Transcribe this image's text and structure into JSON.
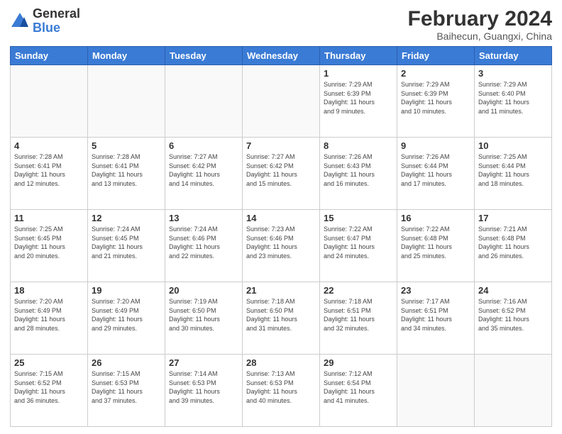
{
  "header": {
    "logo_general": "General",
    "logo_blue": "Blue",
    "title": "February 2024",
    "subtitle": "Baihecun, Guangxi, China"
  },
  "weekdays": [
    "Sunday",
    "Monday",
    "Tuesday",
    "Wednesday",
    "Thursday",
    "Friday",
    "Saturday"
  ],
  "weeks": [
    [
      {
        "day": "",
        "info": ""
      },
      {
        "day": "",
        "info": ""
      },
      {
        "day": "",
        "info": ""
      },
      {
        "day": "",
        "info": ""
      },
      {
        "day": "1",
        "info": "Sunrise: 7:29 AM\nSunset: 6:39 PM\nDaylight: 11 hours\nand 9 minutes."
      },
      {
        "day": "2",
        "info": "Sunrise: 7:29 AM\nSunset: 6:39 PM\nDaylight: 11 hours\nand 10 minutes."
      },
      {
        "day": "3",
        "info": "Sunrise: 7:29 AM\nSunset: 6:40 PM\nDaylight: 11 hours\nand 11 minutes."
      }
    ],
    [
      {
        "day": "4",
        "info": "Sunrise: 7:28 AM\nSunset: 6:41 PM\nDaylight: 11 hours\nand 12 minutes."
      },
      {
        "day": "5",
        "info": "Sunrise: 7:28 AM\nSunset: 6:41 PM\nDaylight: 11 hours\nand 13 minutes."
      },
      {
        "day": "6",
        "info": "Sunrise: 7:27 AM\nSunset: 6:42 PM\nDaylight: 11 hours\nand 14 minutes."
      },
      {
        "day": "7",
        "info": "Sunrise: 7:27 AM\nSunset: 6:42 PM\nDaylight: 11 hours\nand 15 minutes."
      },
      {
        "day": "8",
        "info": "Sunrise: 7:26 AM\nSunset: 6:43 PM\nDaylight: 11 hours\nand 16 minutes."
      },
      {
        "day": "9",
        "info": "Sunrise: 7:26 AM\nSunset: 6:44 PM\nDaylight: 11 hours\nand 17 minutes."
      },
      {
        "day": "10",
        "info": "Sunrise: 7:25 AM\nSunset: 6:44 PM\nDaylight: 11 hours\nand 18 minutes."
      }
    ],
    [
      {
        "day": "11",
        "info": "Sunrise: 7:25 AM\nSunset: 6:45 PM\nDaylight: 11 hours\nand 20 minutes."
      },
      {
        "day": "12",
        "info": "Sunrise: 7:24 AM\nSunset: 6:45 PM\nDaylight: 11 hours\nand 21 minutes."
      },
      {
        "day": "13",
        "info": "Sunrise: 7:24 AM\nSunset: 6:46 PM\nDaylight: 11 hours\nand 22 minutes."
      },
      {
        "day": "14",
        "info": "Sunrise: 7:23 AM\nSunset: 6:46 PM\nDaylight: 11 hours\nand 23 minutes."
      },
      {
        "day": "15",
        "info": "Sunrise: 7:22 AM\nSunset: 6:47 PM\nDaylight: 11 hours\nand 24 minutes."
      },
      {
        "day": "16",
        "info": "Sunrise: 7:22 AM\nSunset: 6:48 PM\nDaylight: 11 hours\nand 25 minutes."
      },
      {
        "day": "17",
        "info": "Sunrise: 7:21 AM\nSunset: 6:48 PM\nDaylight: 11 hours\nand 26 minutes."
      }
    ],
    [
      {
        "day": "18",
        "info": "Sunrise: 7:20 AM\nSunset: 6:49 PM\nDaylight: 11 hours\nand 28 minutes."
      },
      {
        "day": "19",
        "info": "Sunrise: 7:20 AM\nSunset: 6:49 PM\nDaylight: 11 hours\nand 29 minutes."
      },
      {
        "day": "20",
        "info": "Sunrise: 7:19 AM\nSunset: 6:50 PM\nDaylight: 11 hours\nand 30 minutes."
      },
      {
        "day": "21",
        "info": "Sunrise: 7:18 AM\nSunset: 6:50 PM\nDaylight: 11 hours\nand 31 minutes."
      },
      {
        "day": "22",
        "info": "Sunrise: 7:18 AM\nSunset: 6:51 PM\nDaylight: 11 hours\nand 32 minutes."
      },
      {
        "day": "23",
        "info": "Sunrise: 7:17 AM\nSunset: 6:51 PM\nDaylight: 11 hours\nand 34 minutes."
      },
      {
        "day": "24",
        "info": "Sunrise: 7:16 AM\nSunset: 6:52 PM\nDaylight: 11 hours\nand 35 minutes."
      }
    ],
    [
      {
        "day": "25",
        "info": "Sunrise: 7:15 AM\nSunset: 6:52 PM\nDaylight: 11 hours\nand 36 minutes."
      },
      {
        "day": "26",
        "info": "Sunrise: 7:15 AM\nSunset: 6:53 PM\nDaylight: 11 hours\nand 37 minutes."
      },
      {
        "day": "27",
        "info": "Sunrise: 7:14 AM\nSunset: 6:53 PM\nDaylight: 11 hours\nand 39 minutes."
      },
      {
        "day": "28",
        "info": "Sunrise: 7:13 AM\nSunset: 6:53 PM\nDaylight: 11 hours\nand 40 minutes."
      },
      {
        "day": "29",
        "info": "Sunrise: 7:12 AM\nSunset: 6:54 PM\nDaylight: 11 hours\nand 41 minutes."
      },
      {
        "day": "",
        "info": ""
      },
      {
        "day": "",
        "info": ""
      }
    ]
  ]
}
